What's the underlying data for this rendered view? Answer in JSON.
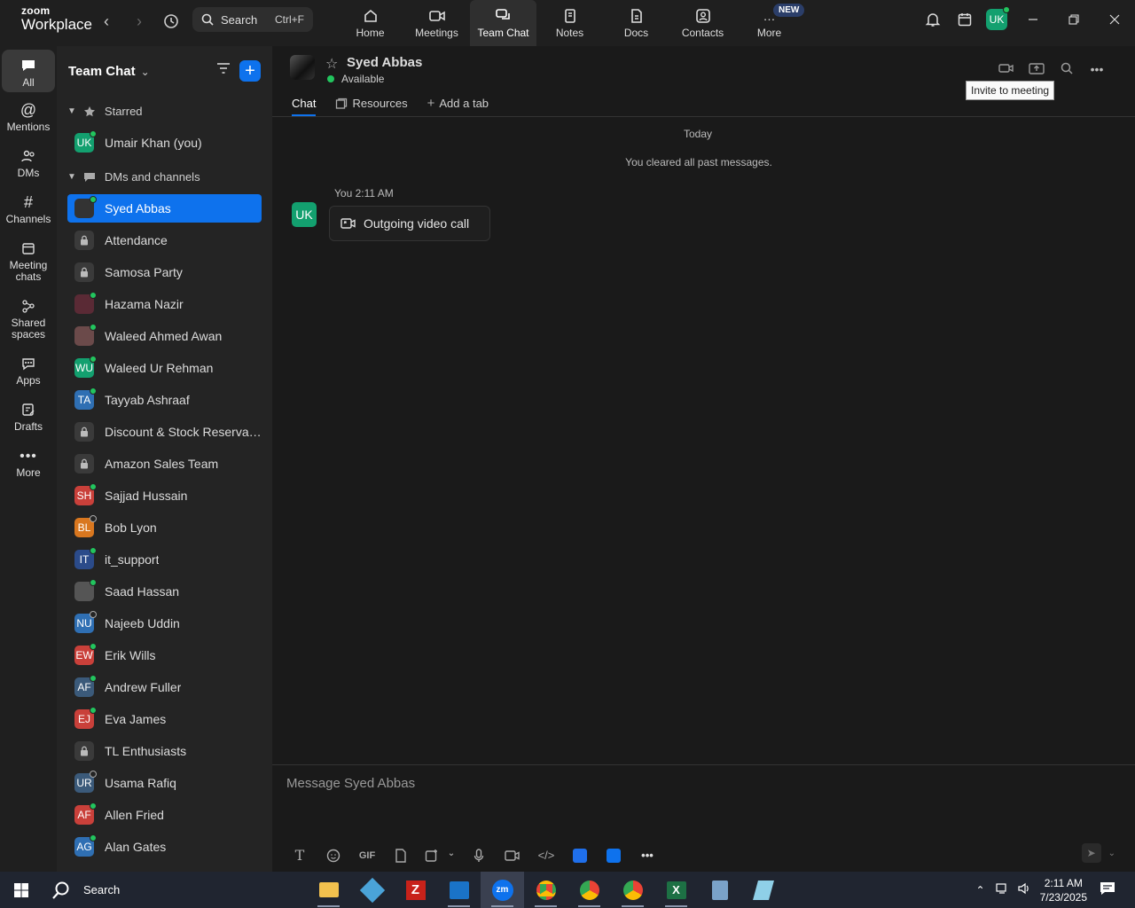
{
  "app": {
    "brand_line1": "zoom",
    "brand_line2": "Workplace"
  },
  "topbar": {
    "search_label": "Search",
    "search_shortcut": "Ctrl+F",
    "nav": [
      {
        "label": "Home",
        "icon": "home-icon"
      },
      {
        "label": "Meetings",
        "icon": "video-camera-icon"
      },
      {
        "label": "Team Chat",
        "icon": "chat-bubbles-icon",
        "active": true
      },
      {
        "label": "Notes",
        "icon": "notes-icon"
      },
      {
        "label": "Docs",
        "icon": "docs-icon"
      },
      {
        "label": "Contacts",
        "icon": "contacts-icon"
      },
      {
        "label": "More",
        "icon": "more-icon"
      }
    ],
    "new_badge": "NEW",
    "user_initials": "UK"
  },
  "rail": {
    "items": [
      {
        "label": "All",
        "icon": "chat-icon",
        "active": true
      },
      {
        "label": "Mentions",
        "icon": "at-icon"
      },
      {
        "label": "DMs",
        "icon": "people-icon"
      },
      {
        "label": "Channels",
        "icon": "hash-icon"
      },
      {
        "label": "Meeting chats",
        "icon": "calendar-icon"
      },
      {
        "label": "Shared spaces",
        "icon": "shared-spaces-icon"
      },
      {
        "label": "Apps",
        "icon": "apps-icon"
      },
      {
        "label": "Drafts",
        "icon": "drafts-icon"
      },
      {
        "label": "More",
        "icon": "ellipsis-icon"
      }
    ]
  },
  "sidebar": {
    "title": "Team Chat",
    "sections": {
      "starred": "Starred",
      "dms": "DMs and channels"
    },
    "starred_items": [
      {
        "name": "Umair Khan (you)",
        "initials": "UK",
        "color": "#13a06f",
        "status": "online"
      }
    ],
    "items": [
      {
        "name": "Syed Abbas",
        "initials": "",
        "color": "#333333",
        "status": "online",
        "selected": true
      },
      {
        "name": "Attendance",
        "initials": "",
        "color": "#3a3a3a",
        "status": "channel"
      },
      {
        "name": "Samosa Party",
        "initials": "",
        "color": "#3a3a3a",
        "status": "channel"
      },
      {
        "name": "Hazama Nazir",
        "initials": "",
        "color": "#5a2a35",
        "status": "online"
      },
      {
        "name": "Waleed Ahmed Awan",
        "initials": "",
        "color": "#6b4a4a",
        "status": "online"
      },
      {
        "name": "Waleed Ur Rehman",
        "initials": "WU",
        "color": "#13a06f",
        "status": "online"
      },
      {
        "name": "Tayyab Ashraaf",
        "initials": "TA",
        "color": "#2f6fb3",
        "status": "online"
      },
      {
        "name": "Discount & Stock Reservati...",
        "initials": "",
        "color": "#3a3a3a",
        "status": "channel"
      },
      {
        "name": "Amazon Sales Team",
        "initials": "",
        "color": "#3a3a3a",
        "status": "channel"
      },
      {
        "name": "Sajjad Hussain",
        "initials": "SH",
        "color": "#c9403a",
        "status": "online"
      },
      {
        "name": "Bob Lyon",
        "initials": "BL",
        "color": "#d9771f",
        "status": "offline"
      },
      {
        "name": "it_support",
        "initials": "IT",
        "color": "#2b4b8a",
        "status": "online"
      },
      {
        "name": "Saad Hassan",
        "initials": "",
        "color": "#555555",
        "status": "online"
      },
      {
        "name": "Najeeb Uddin",
        "initials": "NU",
        "color": "#2f6fb3",
        "status": "offline"
      },
      {
        "name": "Erik Wills",
        "initials": "EW",
        "color": "#c9403a",
        "status": "online"
      },
      {
        "name": "Andrew Fuller",
        "initials": "AF",
        "color": "#3b5a7a",
        "status": "online"
      },
      {
        "name": "Eva James",
        "initials": "EJ",
        "color": "#c9403a",
        "status": "online"
      },
      {
        "name": "TL Enthusiasts",
        "initials": "",
        "color": "#3a3a3a",
        "status": "channel"
      },
      {
        "name": "Usama Rafiq",
        "initials": "UR",
        "color": "#3b5a7a",
        "status": "offline"
      },
      {
        "name": "Allen Fried",
        "initials": "AF",
        "color": "#c9403a",
        "status": "online"
      },
      {
        "name": "Alan Gates",
        "initials": "AG",
        "color": "#2f6fb3",
        "status": "online"
      }
    ]
  },
  "chat": {
    "contact_name": "Syed Abbas",
    "status": "Available",
    "tabs": [
      "Chat",
      "Resources",
      "Add a tab"
    ],
    "tooltip": "Invite to meeting",
    "day_label": "Today",
    "system_message": "You cleared all past messages.",
    "message": {
      "sender_initials": "UK",
      "meta": "You 2:11 AM",
      "text": "Outgoing video call"
    },
    "composer_placeholder": "Message Syed Abbas",
    "gif_label": "GIF"
  },
  "taskbar": {
    "search_label": "Search",
    "time": "2:11 AM",
    "date": "7/23/2025"
  }
}
